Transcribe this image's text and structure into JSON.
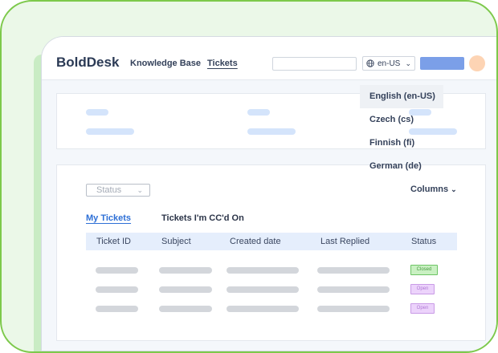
{
  "header": {
    "logo": "BoldDesk",
    "nav": [
      "Knowledge Base",
      "Tickets"
    ],
    "search_value": "",
    "language": "en-US",
    "globe_icon": "globe-icon"
  },
  "language_menu": [
    "English (en-US)",
    "Czech (cs)",
    "Finnish (fi)",
    "German (de)"
  ],
  "filters": {
    "status_label": "Status",
    "columns_label": "Columns"
  },
  "tabs": [
    "My Tickets",
    "Tickets I'm CC'd On"
  ],
  "table": {
    "columns": [
      "Ticket ID",
      "Subject",
      "Created date",
      "Last Replied",
      "Status"
    ],
    "row_status": [
      "Closed",
      "Open",
      "Open"
    ]
  },
  "colors": {
    "accent": "#2d6fd6",
    "button": "#7b9fe8",
    "border": "#7dc94b"
  }
}
